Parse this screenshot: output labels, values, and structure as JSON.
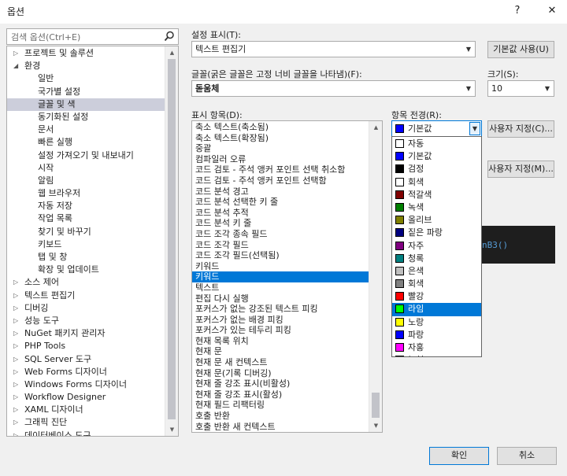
{
  "window": {
    "title": "옵션",
    "help": "?",
    "close": "✕"
  },
  "search": {
    "placeholder": "검색 옵션(Ctrl+E)"
  },
  "tree": {
    "items": [
      {
        "label": "프로젝트 및 솔루션",
        "indent": 0,
        "arrow": "▷"
      },
      {
        "label": "환경",
        "indent": 0,
        "arrow": "◢"
      },
      {
        "label": "일반",
        "indent": 1,
        "arrow": ""
      },
      {
        "label": "국가별 설정",
        "indent": 1,
        "arrow": ""
      },
      {
        "label": "글꼴 및 색",
        "indent": 1,
        "arrow": "",
        "selected": true
      },
      {
        "label": "동기화된 설정",
        "indent": 1,
        "arrow": ""
      },
      {
        "label": "문서",
        "indent": 1,
        "arrow": ""
      },
      {
        "label": "빠른 실행",
        "indent": 1,
        "arrow": ""
      },
      {
        "label": "설정 가져오기 및 내보내기",
        "indent": 1,
        "arrow": ""
      },
      {
        "label": "시작",
        "indent": 1,
        "arrow": ""
      },
      {
        "label": "알림",
        "indent": 1,
        "arrow": ""
      },
      {
        "label": "웹 브라우저",
        "indent": 1,
        "arrow": ""
      },
      {
        "label": "자동 저장",
        "indent": 1,
        "arrow": ""
      },
      {
        "label": "작업 목록",
        "indent": 1,
        "arrow": ""
      },
      {
        "label": "찾기 및 바꾸기",
        "indent": 1,
        "arrow": ""
      },
      {
        "label": "키보드",
        "indent": 1,
        "arrow": ""
      },
      {
        "label": "탭 및 창",
        "indent": 1,
        "arrow": ""
      },
      {
        "label": "확장 및 업데이트",
        "indent": 1,
        "arrow": ""
      },
      {
        "label": "소스 제어",
        "indent": 0,
        "arrow": "▷"
      },
      {
        "label": "텍스트 편집기",
        "indent": 0,
        "arrow": "▷"
      },
      {
        "label": "디버깅",
        "indent": 0,
        "arrow": "▷"
      },
      {
        "label": "성능 도구",
        "indent": 0,
        "arrow": "▷"
      },
      {
        "label": "NuGet 패키지 관리자",
        "indent": 0,
        "arrow": "▷"
      },
      {
        "label": "PHP Tools",
        "indent": 0,
        "arrow": "▷"
      },
      {
        "label": "SQL Server 도구",
        "indent": 0,
        "arrow": "▷"
      },
      {
        "label": "Web Forms 디자이너",
        "indent": 0,
        "arrow": "▷"
      },
      {
        "label": "Windows Forms 디자이너",
        "indent": 0,
        "arrow": "▷"
      },
      {
        "label": "Workflow Designer",
        "indent": 0,
        "arrow": "▷"
      },
      {
        "label": "XAML 디자이너",
        "indent": 0,
        "arrow": "▷"
      },
      {
        "label": "그래픽 진단",
        "indent": 0,
        "arrow": "▷"
      },
      {
        "label": "데이터베이스 도구",
        "indent": 0,
        "arrow": "▷"
      }
    ]
  },
  "settings": {
    "label": "설정 표시(T):",
    "value": "텍스트 편집기",
    "default_button": "기본값 사용(U)"
  },
  "font": {
    "label": "글꼴(굵은 글꼴은 고정 너비 글꼴을 나타냄)(F):",
    "value": "돋움체"
  },
  "size": {
    "label": "크기(S):",
    "value": "10"
  },
  "display_items": {
    "label": "표시 항목(D):",
    "items": [
      {
        "label": "축소 텍스트(축소됨)"
      },
      {
        "label": "축소 텍스트(확장됨)"
      },
      {
        "label": "중괄"
      },
      {
        "label": "컴파일러 오류"
      },
      {
        "label": "코드 검토 - 주석 앵커 포인트 선택 취소함"
      },
      {
        "label": "코드 검토 - 주석 앵커 포인트 선택함"
      },
      {
        "label": "코드 분석 경고"
      },
      {
        "label": "코드 분석 선택한 키 줄"
      },
      {
        "label": "코드 분석 추적"
      },
      {
        "label": "코드 분석 키 줄"
      },
      {
        "label": "코드 조각 종속 필드"
      },
      {
        "label": "코드 조각 필드"
      },
      {
        "label": "코드 조각 필드(선택됨)"
      },
      {
        "label": "키워드"
      },
      {
        "label": "키워드",
        "selected": true
      },
      {
        "label": "텍스트"
      },
      {
        "label": "편집 다시 실행"
      },
      {
        "label": "포커스가 없는 강조된 텍스트 피킹"
      },
      {
        "label": "포커스가 없는 배경 피킹"
      },
      {
        "label": "포커스가 있는 테두리 피킹"
      },
      {
        "label": "현재 목록 위치"
      },
      {
        "label": "현재 문"
      },
      {
        "label": "현재 문 새 컨텍스트"
      },
      {
        "label": "현재 문(기록 디버깅)"
      },
      {
        "label": "현재 줄 강조 표시(비활성)"
      },
      {
        "label": "현재 줄 강조 표시(활성)"
      },
      {
        "label": "현재 필드 리팩터링"
      },
      {
        "label": "호출 반환"
      },
      {
        "label": "호출 반환 새 컨텍스트"
      }
    ]
  },
  "foreground": {
    "label": "항목 전경(R):",
    "selected": {
      "label": "기본값",
      "color": "#0000ff"
    },
    "custom_button": "사용자 지정(C)...",
    "options": [
      {
        "label": "자동",
        "color": "#ffffff"
      },
      {
        "label": "기본값",
        "color": "#0000ff"
      },
      {
        "label": "검정",
        "color": "#000000"
      },
      {
        "label": "회색",
        "color": "#ffffff"
      },
      {
        "label": "적갈색",
        "color": "#800000"
      },
      {
        "label": "녹색",
        "color": "#008000"
      },
      {
        "label": "올리브",
        "color": "#808000"
      },
      {
        "label": "짙은 파랑",
        "color": "#000080"
      },
      {
        "label": "자주",
        "color": "#800080"
      },
      {
        "label": "청록",
        "color": "#008080"
      },
      {
        "label": "은색",
        "color": "#c0c0c0"
      },
      {
        "label": "회색",
        "color": "#808080"
      },
      {
        "label": "빨강",
        "color": "#ff0000"
      },
      {
        "label": "라임",
        "color": "#00ff00",
        "selected": true
      },
      {
        "label": "노랑",
        "color": "#ffff00"
      },
      {
        "label": "파랑",
        "color": "#0000ff"
      },
      {
        "label": "자홍",
        "color": "#ff00ff"
      },
      {
        "label": "녹청",
        "color": "#00ffff"
      }
    ]
  },
  "background": {
    "custom_button": "사용자 지정(M)..."
  },
  "preview": {
    "text": "nB3()"
  },
  "footer": {
    "ok": "확인",
    "cancel": "취소"
  }
}
